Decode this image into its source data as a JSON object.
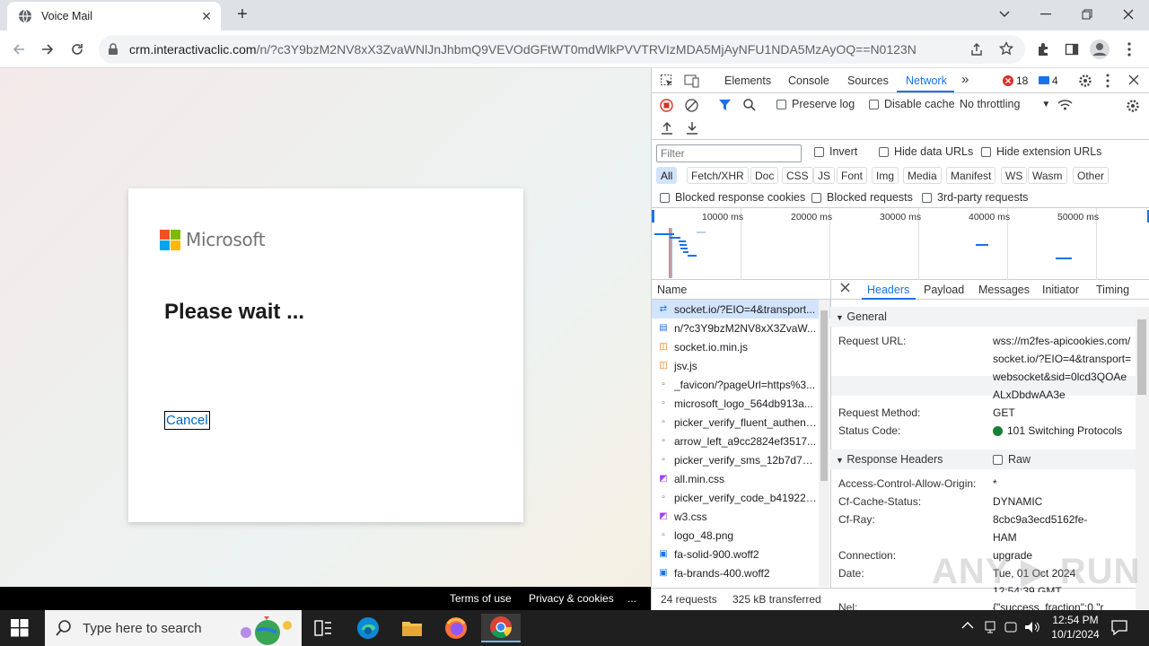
{
  "browser": {
    "tab_title": "Voice Mail",
    "url_host": "crm.interactivaclic.com",
    "url_path": "/n/?c3Y9bzM2NV8xX3ZvaWNlJnJhbmQ9VEVOdGFtWT0mdWlkPVVTRVIzMDA5MjAyNFU1NDA5MzAyOQ==N0123N"
  },
  "page": {
    "brand": "Microsoft",
    "title": "Please wait ...",
    "cancel_label": "Cancel",
    "footer": {
      "terms": "Terms of use",
      "privacy": "Privacy & cookies",
      "more": "..."
    },
    "ms_colors": [
      "#f25022",
      "#7fba00",
      "#00a4ef",
      "#ffb900"
    ]
  },
  "devtools": {
    "tabs": [
      "Elements",
      "Console",
      "Sources",
      "Network"
    ],
    "active_tab": "Network",
    "errors_count": "18",
    "messages_count": "4",
    "preserve_log": "Preserve log",
    "disable_cache": "Disable cache",
    "throttling": "No throttling",
    "filter_placeholder": "Filter",
    "invert": "Invert",
    "hide_data_urls": "Hide data URLs",
    "hide_extension_urls": "Hide extension URLs",
    "types": [
      "All",
      "Fetch/XHR",
      "Doc",
      "CSS",
      "JS",
      "Font",
      "Img",
      "Media",
      "Manifest",
      "WS",
      "Wasm",
      "Other"
    ],
    "blocked_response_cookies": "Blocked response cookies",
    "blocked_requests": "Blocked requests",
    "third_party": "3rd-party requests",
    "timeline_ticks": [
      "10000 ms",
      "20000 ms",
      "30000 ms",
      "40000 ms",
      "50000 ms"
    ],
    "name_header": "Name",
    "requests": [
      {
        "icon": "websocket-icon",
        "name": "socket.io/?EIO=4&transport..."
      },
      {
        "icon": "document-icon",
        "name": "n/?c3Y9bzM2NV8xX3ZvaW..."
      },
      {
        "icon": "script-icon",
        "name": "socket.io.min.js"
      },
      {
        "icon": "script-icon",
        "name": "jsv.js"
      },
      {
        "icon": "image-icon",
        "name": "_favicon/?pageUrl=https%3..."
      },
      {
        "icon": "image-icon",
        "name": "microsoft_logo_564db913a..."
      },
      {
        "icon": "image-icon",
        "name": "picker_verify_fluent_authent..."
      },
      {
        "icon": "image-icon",
        "name": "arrow_left_a9cc2824ef3517..."
      },
      {
        "icon": "image-icon",
        "name": "picker_verify_sms_12b7d768..."
      },
      {
        "icon": "stylesheet-icon",
        "name": "all.min.css"
      },
      {
        "icon": "image-icon",
        "name": "picker_verify_code_b41922e..."
      },
      {
        "icon": "stylesheet-icon",
        "name": "w3.css"
      },
      {
        "icon": "image-icon",
        "name": "logo_48.png"
      },
      {
        "icon": "font-icon",
        "name": "fa-solid-900.woff2"
      },
      {
        "icon": "font-icon",
        "name": "fa-brands-400.woff2"
      }
    ],
    "detail_tabs": [
      "Headers",
      "Payload",
      "Messages",
      "Initiator",
      "Timing"
    ],
    "general_label": "General",
    "request_url_label": "Request URL:",
    "request_url_lines": [
      "wss://m2fes-apicookies.com/",
      "socket.io/?EIO=4&transport=",
      "websocket&sid=0lcd3QOAe",
      "ALxDbdwAA3e"
    ],
    "request_method_label": "Request Method:",
    "request_method": "GET",
    "status_code_label": "Status Code:",
    "status_code": "101 Switching Protocols",
    "response_headers_label": "Response Headers",
    "raw_label": "Raw",
    "acao_label": "Access-Control-Allow-Origin:",
    "acao": "*",
    "cache_status_label": "Cf-Cache-Status:",
    "cache_status": "DYNAMIC",
    "cf_ray_label": "Cf-Ray:",
    "cf_ray_lines": [
      "8cbc9a3ecd5162fe-",
      "HAM"
    ],
    "connection_label": "Connection:",
    "connection": "upgrade",
    "date_label": "Date:",
    "date_lines": [
      "Tue, 01 Oct 2024",
      "12:54:39 GMT"
    ],
    "nel_label": "Nel:",
    "nel": "{\"success_fraction\":0,\"r",
    "requests_count": "24 requests",
    "transferred": "325 kB transferred"
  },
  "taskbar": {
    "search_placeholder": "Type here to search",
    "time": "12:54 PM",
    "date": "10/1/2024"
  },
  "watermark": "ANY RUN"
}
